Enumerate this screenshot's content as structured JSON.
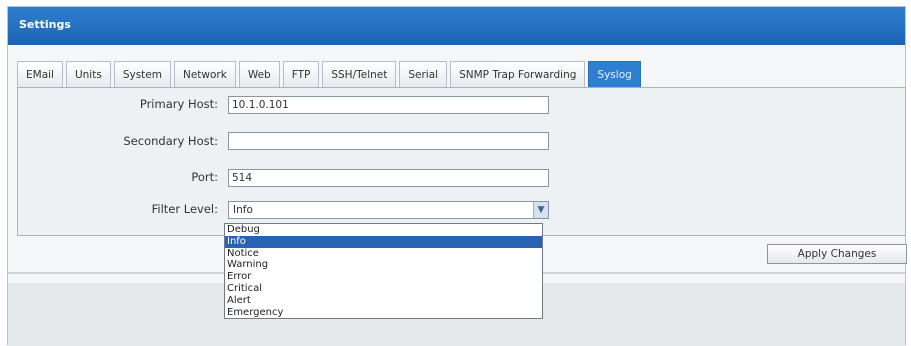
{
  "window": {
    "title": "Settings"
  },
  "tabs": [
    {
      "label": "EMail"
    },
    {
      "label": "Units"
    },
    {
      "label": "System"
    },
    {
      "label": "Network"
    },
    {
      "label": "Web"
    },
    {
      "label": "FTP"
    },
    {
      "label": "SSH/Telnet"
    },
    {
      "label": "Serial"
    },
    {
      "label": "SNMP Trap Forwarding"
    },
    {
      "label": "Syslog",
      "active": true
    }
  ],
  "form": {
    "primary_host_label": "Primary Host:",
    "primary_host_value": "10.1.0.101",
    "secondary_host_label": "Secondary Host:",
    "secondary_host_value": "",
    "port_label": "Port:",
    "port_value": "514",
    "filter_level_label": "Filter Level:",
    "filter_level_value": "Info"
  },
  "filter_level_options": [
    "Debug",
    "Info",
    "Notice",
    "Warning",
    "Error",
    "Critical",
    "Alert",
    "Emergency"
  ],
  "filter_level_selected": "Info",
  "apply_button": "Apply Changes",
  "colors": {
    "title_bar": "#1f6bbd",
    "active_tab": "#2e7ed2",
    "selected_option": "#2862b3"
  },
  "icons": {
    "select_arrow": "chevron-down-icon"
  }
}
